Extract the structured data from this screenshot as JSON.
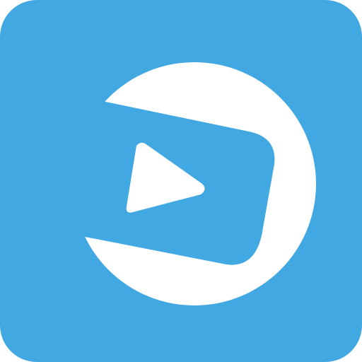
{
  "icon": {
    "name": "video-player-app-icon",
    "glyph": "play-icon",
    "colors": {
      "background": "#42A8E2",
      "foreground": "#FFFFFF"
    }
  }
}
